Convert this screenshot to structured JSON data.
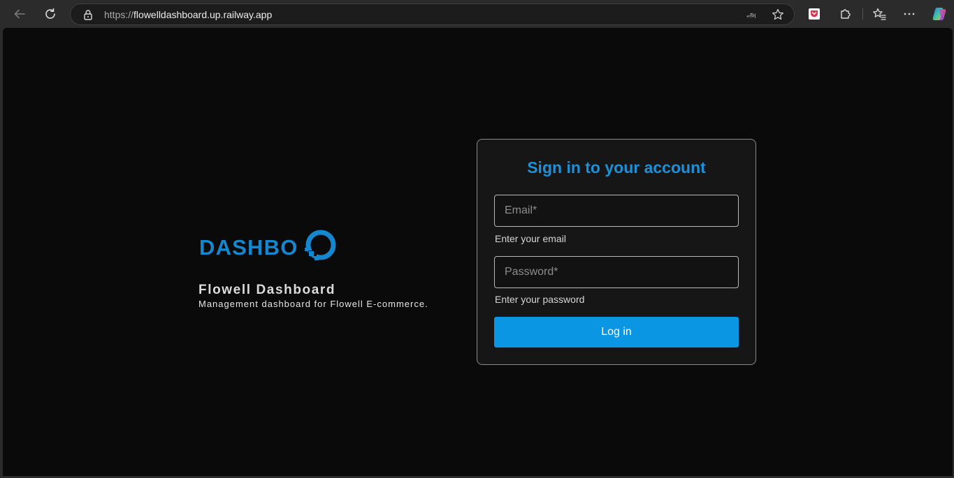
{
  "browser": {
    "url_scheme": "https://",
    "url_host": "flowelldashboard.up.railway.app",
    "translate_glyph": "அ"
  },
  "brand": {
    "logo_text": "DASHBO",
    "title": "Flowell Dashboard",
    "subtitle": "Management dashboard for Flowell E-commerce."
  },
  "login_card": {
    "title": "Sign in to your account",
    "email_placeholder": "Email*",
    "email_value": "",
    "email_helper": "Enter your email",
    "password_placeholder": "Password*",
    "password_value": "",
    "password_helper": "Enter your password",
    "submit_label": "Log in"
  },
  "colors": {
    "accent": "#0a96e2",
    "title": "#1e90d8",
    "page_background": "#0a0a0b",
    "card_background": "#161616"
  }
}
